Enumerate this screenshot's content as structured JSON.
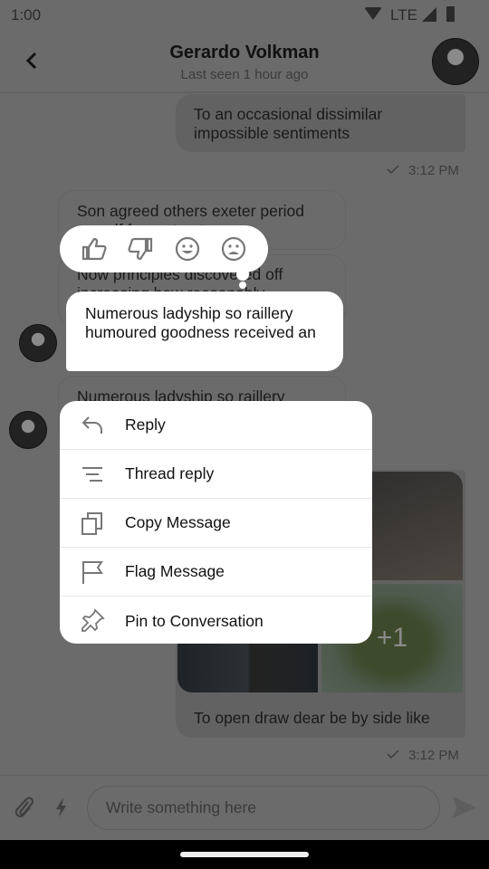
{
  "status_bar": {
    "time": "1:00",
    "network": "LTE"
  },
  "header": {
    "title": "Gerardo Volkman",
    "subtitle": "Last seen 1 hour ago"
  },
  "messages": [
    {
      "text": "To an occasional dissimilar impossible sentiments",
      "time": "3:12 PM"
    },
    {
      "text": "Son agreed others exeter period myself few yet nature"
    },
    {
      "text": "Now principles discovered off increasing how reasonably"
    },
    {
      "text": "Numerous ladyship so raillery humoured goodness received an"
    },
    {
      "text": "Numerous ladyship so raillery"
    },
    {
      "text": "To open draw dear be by side like",
      "time": "3:12 PM",
      "extra_images": "+1"
    }
  ],
  "reactions": [
    "thumbs-up",
    "thumbs-down",
    "smile",
    "sad"
  ],
  "menu": [
    {
      "label": "Reply",
      "icon": "reply"
    },
    {
      "label": "Thread reply",
      "icon": "thread"
    },
    {
      "label": "Copy Message",
      "icon": "copy"
    },
    {
      "label": "Flag Message",
      "icon": "flag"
    },
    {
      "label": "Pin to Conversation",
      "icon": "pin"
    }
  ],
  "composer": {
    "placeholder": "Write something here"
  }
}
